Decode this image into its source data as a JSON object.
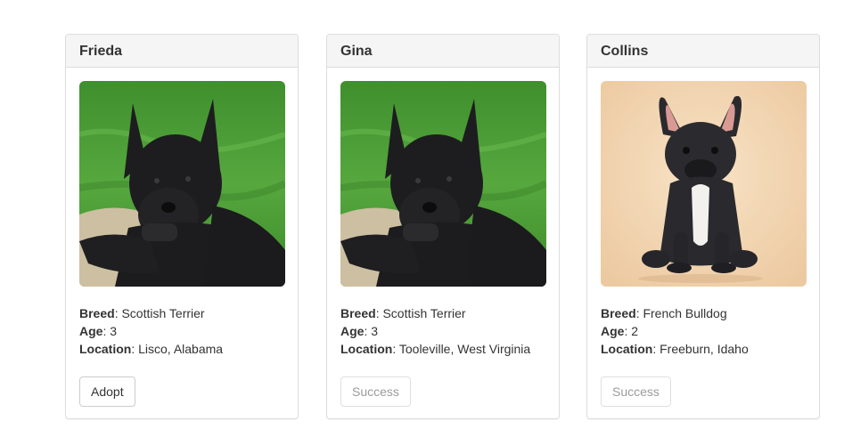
{
  "cards": [
    {
      "name": "Frieda",
      "photo_icon": "scottish-terrier-photo",
      "breed_label": "Breed",
      "breed": "Scottish Terrier",
      "age_label": "Age",
      "age": "3",
      "location_label": "Location",
      "location": "Lisco, Alabama",
      "button_label": "Adopt",
      "button_state": "enabled"
    },
    {
      "name": "Gina",
      "photo_icon": "scottish-terrier-photo",
      "breed_label": "Breed",
      "breed": "Scottish Terrier",
      "age_label": "Age",
      "age": "3",
      "location_label": "Location",
      "location": "Tooleville, West Virginia",
      "button_label": "Success",
      "button_state": "disabled"
    },
    {
      "name": "Collins",
      "photo_icon": "french-bulldog-photo",
      "breed_label": "Breed",
      "breed": "French Bulldog",
      "age_label": "Age",
      "age": "2",
      "location_label": "Location",
      "location": "Freeburn, Idaho",
      "button_label": "Success",
      "button_state": "disabled"
    }
  ],
  "colors": {
    "panel_border": "#dddddd",
    "panel_header_bg": "#f5f5f5",
    "grass": "#4f9e3a",
    "terrier_fur": "#1d1d1f",
    "bulldog_bg": "#f2d7b4"
  }
}
